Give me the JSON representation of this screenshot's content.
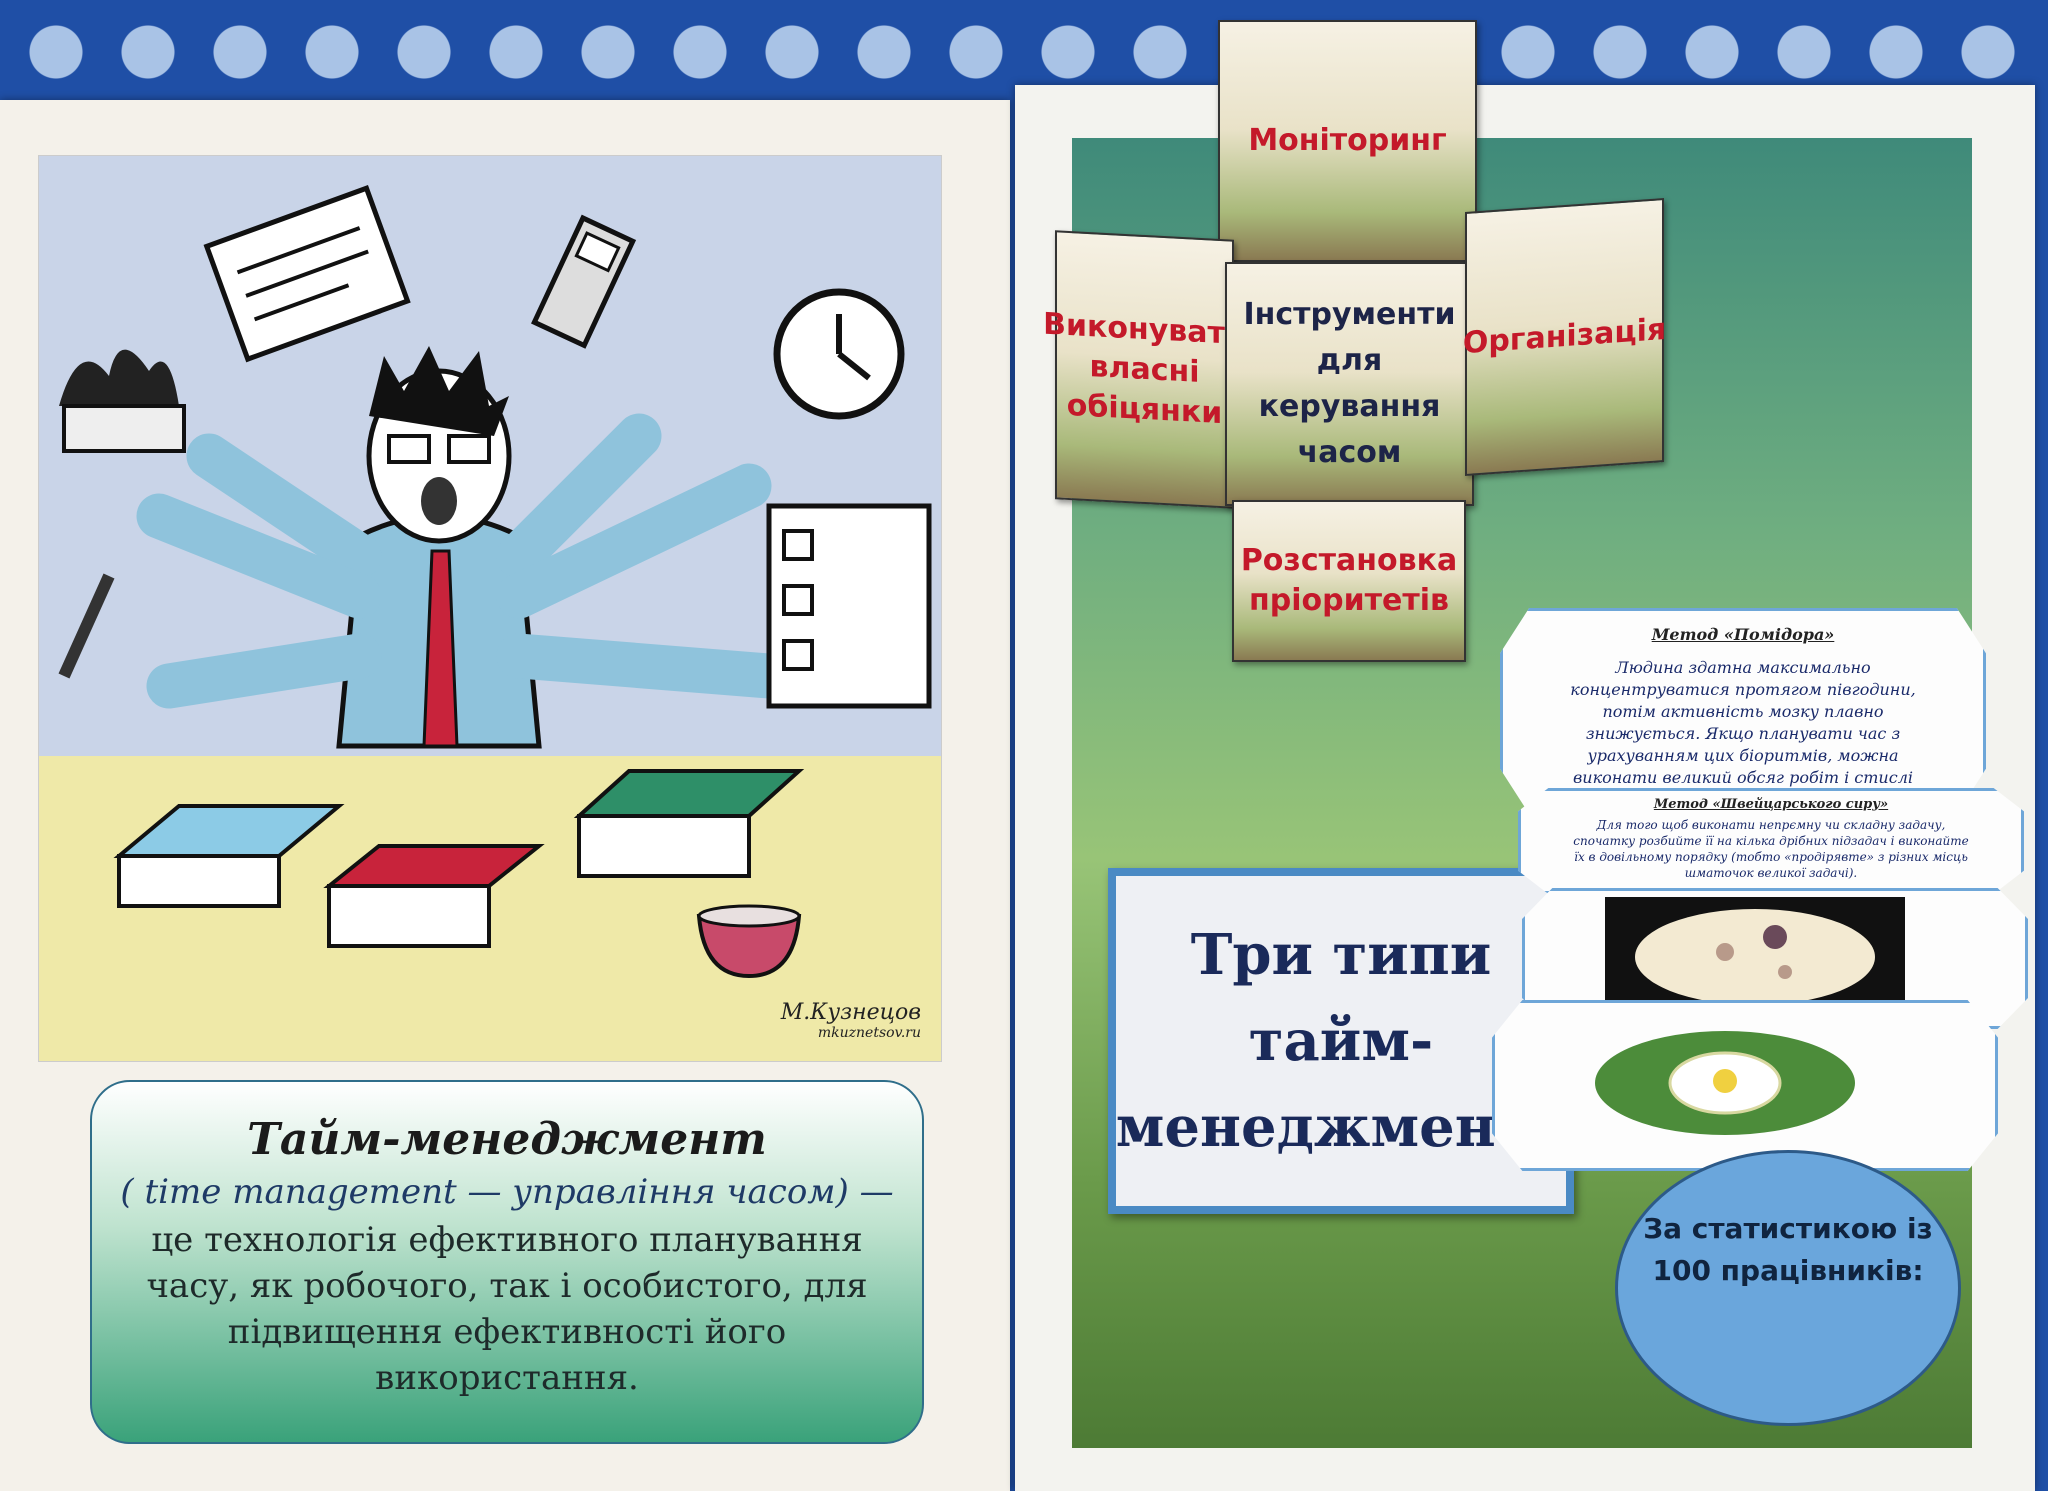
{
  "left_page": {
    "definition": {
      "title": "Тайм-менеджмент",
      "subtitle": "( time management — управління часом) —",
      "body": "це технологія ефективного планування часу, як робочого, так і особистого, для підвищення ефективності його використання."
    },
    "illustration": {
      "signature": "М.Кузнецов",
      "site": "mkuznetsov.ru"
    }
  },
  "right_page": {
    "flaps": {
      "top": "Моніторинг",
      "left": "Виконувати власні обіцянки",
      "center": "Інструменти для керування часом",
      "right": "Організація",
      "bottom": "Розстановка пріоритетів"
    },
    "types_title": "Три типи тайм-менеджменту",
    "pomodoro": {
      "title": "Метод «Помідора»",
      "body": "Людина здатна максимально концентруватися протягом півгодини, потім активність мозку плавно знижується. Якщо планувати час з урахуванням цих біоритмів, можна виконати великий обсяг робіт і стислі терміни."
    },
    "swiss": {
      "title": "Метод «Швейцарського сиру»",
      "body": "Для того щоб виконати непрємну чи складну задачу, спочатку розбийте її на кілька дрібних підзадач і виконайте їх в довільному порядку (тобто «продірявте» з різних місць шматочок великої задачі)."
    },
    "stats": "За статистикою із 100 працівників:"
  },
  "colors": {
    "tablecloth": "#1f4fa6",
    "flap_red_text": "#c4192a",
    "types_border": "#4a8ac4",
    "stats_circle": "#6aa6dc"
  }
}
